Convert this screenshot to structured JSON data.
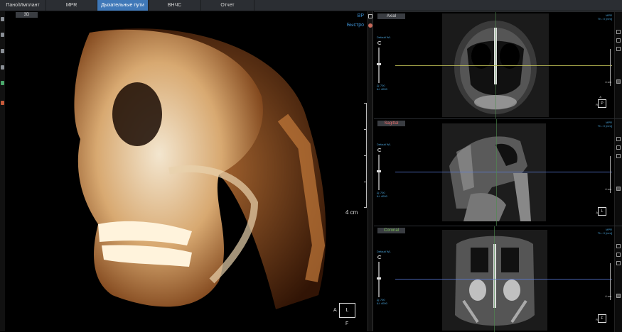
{
  "tabs": [
    {
      "label": "Пано/Имплант",
      "active": false
    },
    {
      "label": "MPR",
      "active": false
    },
    {
      "label": "Дыхательные пути",
      "active": true
    },
    {
      "label": "ВНЧС",
      "active": false
    },
    {
      "label": "Отчет",
      "active": false
    }
  ],
  "view3d": {
    "tag": "3D",
    "mode_top": "ВР",
    "mode_quality": "Быстро",
    "scale_label": "4 cm",
    "orient_box": "L",
    "orient_left": "A",
    "orient_bottom": "F",
    "presets_count": 8
  },
  "panels": [
    {
      "tag": "Axial",
      "tag_color": "#d6d6d6",
      "wl_label": "Default WL",
      "wl_values": [
        "Д: 700",
        "Ш: 4000"
      ],
      "mpr_text": [
        "MPR",
        "Th.: 0 [mm]"
      ],
      "scale_label": "4 cm",
      "box": "P",
      "box_top": "A",
      "box_left": "R",
      "line_color": "#c8c85a"
    },
    {
      "tag": "Sagittal",
      "tag_color": "#e06a6a",
      "wl_label": "Default WL",
      "wl_values": [
        "Д: 700",
        "Ш: 4000"
      ],
      "mpr_text": [
        "MPR",
        "Th.: 0 [mm]"
      ],
      "scale_label": "4 cm",
      "box": "L",
      "box_top": "",
      "box_left": "A",
      "line_color": "#5a7ad8"
    },
    {
      "tag": "Coronal",
      "tag_color": "#7fc05a",
      "wl_label": "Default WL",
      "wl_values": [
        "Д: 700",
        "Ш: 4000"
      ],
      "mpr_text": [
        "MPR",
        "Th.: 0 [mm]"
      ],
      "scale_label": "4 cm",
      "box": "F",
      "box_top": "",
      "box_left": "R",
      "line_color": "#5a7ad8"
    }
  ]
}
